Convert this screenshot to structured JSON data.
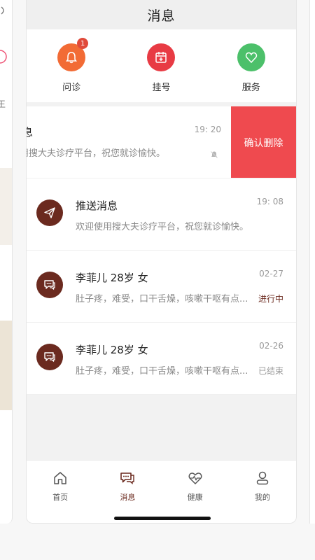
{
  "side_left": {
    "peek_glyph": "王"
  },
  "header": {
    "title": "消息"
  },
  "quick_actions": [
    {
      "label": "问诊",
      "icon": "bell-icon",
      "color": "#f26b35",
      "badge": "1"
    },
    {
      "label": "挂号",
      "icon": "calendar-icon",
      "color": "#e83b44"
    },
    {
      "label": "服务",
      "icon": "heart-icon",
      "color": "#4cc06a"
    }
  ],
  "swiped_message": {
    "name": "统消息",
    "preview": "迎使用搜大夫诊疗平台，祝您就诊愉快。",
    "time": "19: 20",
    "delete_label": "确认删除",
    "delete_color": "#ef4a4f"
  },
  "messages": [
    {
      "name": "推送消息",
      "preview": "欢迎使用搜大夫诊疗平台，祝您就诊愉快。",
      "time": "19: 08",
      "icon": "send-icon",
      "status": ""
    },
    {
      "name": "李菲儿  28岁  女",
      "preview": "肚子疼，难受，口干舌燥，咳嗽干呕有点...",
      "time": "02-27",
      "icon": "chat-icon",
      "status": "进行中",
      "status_color": "#6b2a1f"
    },
    {
      "name": "李菲儿  28岁  女",
      "preview": "肚子疼，难受，口干舌燥，咳嗽干呕有点...",
      "time": "02-26",
      "icon": "chat-icon",
      "status": "已结束",
      "status_color": "#999999"
    }
  ],
  "tabbar": [
    {
      "label": "首页",
      "icon": "home-icon",
      "active": false
    },
    {
      "label": "消息",
      "icon": "messages-icon",
      "active": true
    },
    {
      "label": "健康",
      "icon": "health-icon",
      "active": false
    },
    {
      "label": "我的",
      "icon": "profile-icon",
      "active": false
    }
  ],
  "colors": {
    "brand": "#6b2a1f"
  }
}
